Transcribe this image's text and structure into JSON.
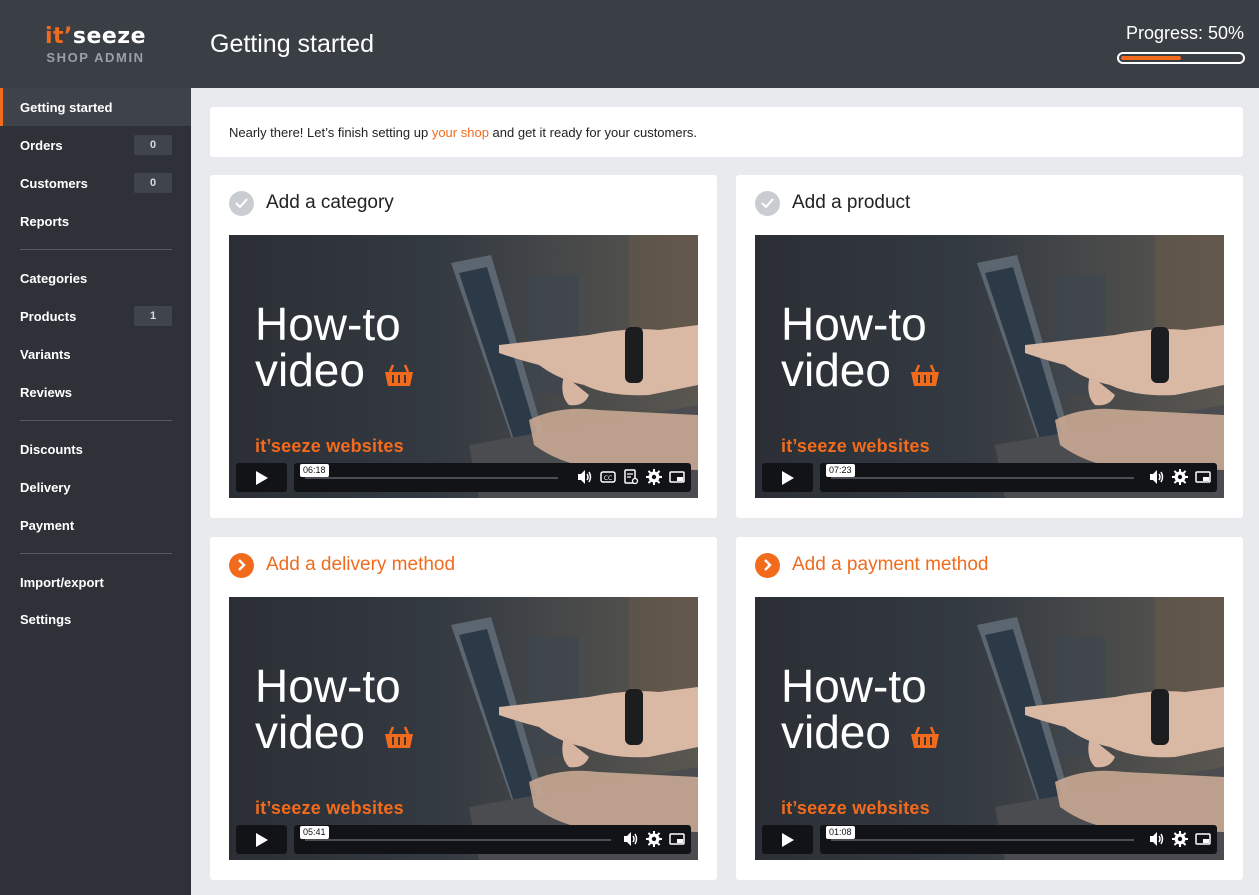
{
  "brand": {
    "part1": "it",
    "part2": "’",
    "part3": "seeze",
    "sub": "SHOP ADMIN"
  },
  "sidebar": {
    "items": [
      {
        "label": "Getting started"
      },
      {
        "label": "Orders",
        "badge": "0"
      },
      {
        "label": "Customers",
        "badge": "0"
      },
      {
        "label": "Reports"
      },
      {
        "label": "Categories"
      },
      {
        "label": "Products",
        "badge": "1"
      },
      {
        "label": "Variants"
      },
      {
        "label": "Reviews"
      },
      {
        "label": "Discounts"
      },
      {
        "label": "Delivery"
      },
      {
        "label": "Payment"
      },
      {
        "label": "Import/export"
      },
      {
        "label": "Settings"
      }
    ]
  },
  "header": {
    "title": "Getting started",
    "progress_label": "Progress: 50%",
    "progress_value": 0.5
  },
  "intro": {
    "before": "Nearly there! Let’s finish setting up ",
    "link": "your shop",
    "after": " and get it ready for your customers."
  },
  "cards": [
    {
      "title": "Add a category",
      "status": "done",
      "video": {
        "headline1": "How-to",
        "headline2": "video",
        "brand_a": "it’seeze",
        "brand_b": "websites",
        "duration": "06:18"
      }
    },
    {
      "title": "Add a product",
      "status": "done",
      "video": {
        "headline1": "How-to",
        "headline2": "video",
        "brand_a": "it’seeze",
        "brand_b": "websites",
        "duration": "07:23"
      }
    },
    {
      "title": "Add a delivery method",
      "status": "todo",
      "video": {
        "headline1": "How-to",
        "headline2": "video",
        "brand_a": "it’seeze",
        "brand_b": "websites",
        "duration": "05:41"
      }
    },
    {
      "title": "Add a payment method",
      "status": "todo",
      "video": {
        "headline1": "How-to",
        "headline2": "video",
        "brand_a": "it’seeze",
        "brand_b": "websites",
        "duration": "01:08"
      }
    }
  ],
  "colors": {
    "accent": "#f26b1d",
    "sidebar": "#2e3238",
    "header": "#3a3f46",
    "done_icon": "#c9cdd2"
  }
}
